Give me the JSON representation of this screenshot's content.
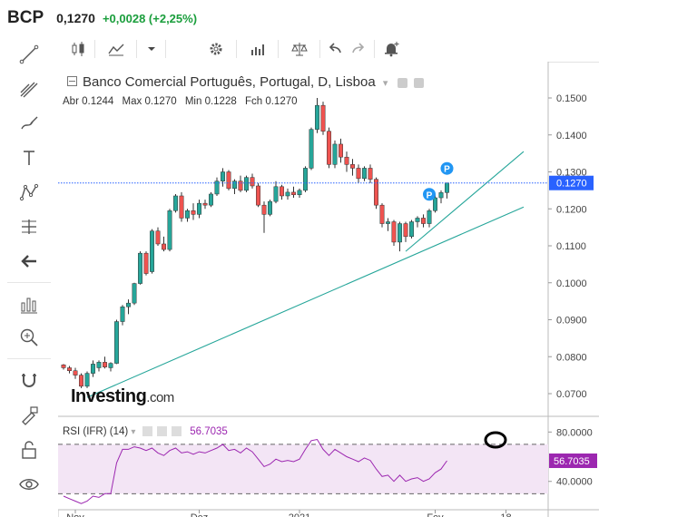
{
  "ticker": {
    "symbol": "BCP",
    "last": "0,1270",
    "change": "+0,0028 (+2,25%)"
  },
  "chart_header": {
    "title": "Banco Comercial Português, Portugal, D, Lisboa",
    "ohlc": [
      {
        "label": "Abr",
        "value": "0.1244"
      },
      {
        "label": "Max",
        "value": "0.1270"
      },
      {
        "label": "Min",
        "value": "0.1228"
      },
      {
        "label": "Fch",
        "value": "0.1270"
      }
    ]
  },
  "logo": {
    "main": "Investing",
    "suffix": ".com"
  },
  "rsi_header": {
    "label": "RSI (IFR) (14)",
    "value": "56.7035"
  },
  "colors": {
    "up": "#26a69a",
    "down": "#ef5350",
    "rsi": "#9c27b0",
    "trend": "#26a69a",
    "last_price": "#2962ff"
  },
  "chart_data": {
    "type": "candlestick",
    "y_ticks": [
      "0.1500",
      "0.1400",
      "0.1300",
      "0.1200",
      "0.1100",
      "0.1000",
      "0.0900",
      "0.0800",
      "0.0700"
    ],
    "ylim": [
      0.066,
      0.155
    ],
    "last_price": 0.127,
    "last_price_label": "0.1270",
    "x_ticks": [
      {
        "label": "Nov",
        "index": 2
      },
      {
        "label": "Dez",
        "index": 23
      },
      {
        "label": "2021",
        "index": 40
      },
      {
        "label": "Fev",
        "index": 63
      },
      {
        "label": "18",
        "index": 75
      }
    ],
    "ohlc": [
      [
        0.0778,
        0.078,
        0.0765,
        0.077
      ],
      [
        0.077,
        0.0775,
        0.0755,
        0.0762
      ],
      [
        0.0762,
        0.077,
        0.074,
        0.075
      ],
      [
        0.075,
        0.0755,
        0.0715,
        0.072
      ],
      [
        0.072,
        0.076,
        0.0715,
        0.0755
      ],
      [
        0.0755,
        0.079,
        0.0745,
        0.078
      ],
      [
        0.077,
        0.079,
        0.076,
        0.0785
      ],
      [
        0.0785,
        0.08,
        0.0768,
        0.0772
      ],
      [
        0.077,
        0.0785,
        0.076,
        0.0782
      ],
      [
        0.0782,
        0.09,
        0.078,
        0.0895
      ],
      [
        0.0895,
        0.094,
        0.0885,
        0.0935
      ],
      [
        0.0935,
        0.0955,
        0.0915,
        0.0945
      ],
      [
        0.0945,
        0.1,
        0.094,
        0.0998
      ],
      [
        0.0998,
        0.1085,
        0.0995,
        0.108
      ],
      [
        0.108,
        0.1085,
        0.102,
        0.1025
      ],
      [
        0.103,
        0.1145,
        0.1025,
        0.114
      ],
      [
        0.114,
        0.115,
        0.11,
        0.1105
      ],
      [
        0.1105,
        0.1125,
        0.1085,
        0.109
      ],
      [
        0.109,
        0.12,
        0.1085,
        0.1195
      ],
      [
        0.1195,
        0.124,
        0.119,
        0.1235
      ],
      [
        0.1235,
        0.1245,
        0.1165,
        0.1175
      ],
      [
        0.1175,
        0.12,
        0.1165,
        0.1195
      ],
      [
        0.1195,
        0.1215,
        0.117,
        0.1185
      ],
      [
        0.1185,
        0.1225,
        0.1175,
        0.1215
      ],
      [
        0.1215,
        0.1225,
        0.12,
        0.121
      ],
      [
        0.121,
        0.1245,
        0.1205,
        0.124
      ],
      [
        0.124,
        0.1285,
        0.1235,
        0.1275
      ],
      [
        0.1275,
        0.131,
        0.126,
        0.13
      ],
      [
        0.13,
        0.1305,
        0.125,
        0.1255
      ],
      [
        0.1255,
        0.128,
        0.124,
        0.1275
      ],
      [
        0.1275,
        0.129,
        0.1245,
        0.125
      ],
      [
        0.125,
        0.129,
        0.1245,
        0.1285
      ],
      [
        0.1285,
        0.1295,
        0.1255,
        0.1262
      ],
      [
        0.1262,
        0.127,
        0.1205,
        0.121
      ],
      [
        0.121,
        0.122,
        0.1135,
        0.1185
      ],
      [
        0.1185,
        0.1225,
        0.118,
        0.122
      ],
      [
        0.122,
        0.1275,
        0.1215,
        0.126
      ],
      [
        0.126,
        0.1265,
        0.1225,
        0.1235
      ],
      [
        0.1235,
        0.1255,
        0.1225,
        0.1245
      ],
      [
        0.1245,
        0.126,
        0.123,
        0.1238
      ],
      [
        0.1238,
        0.1255,
        0.123,
        0.125
      ],
      [
        0.125,
        0.1315,
        0.1245,
        0.131
      ],
      [
        0.131,
        0.142,
        0.1305,
        0.1415
      ],
      [
        0.1415,
        0.15,
        0.1405,
        0.148
      ],
      [
        0.148,
        0.149,
        0.14,
        0.141
      ],
      [
        0.141,
        0.142,
        0.131,
        0.132
      ],
      [
        0.132,
        0.1385,
        0.131,
        0.1375
      ],
      [
        0.1375,
        0.139,
        0.1325,
        0.134
      ],
      [
        0.134,
        0.1355,
        0.13,
        0.132
      ],
      [
        0.132,
        0.1335,
        0.129,
        0.131
      ],
      [
        0.131,
        0.132,
        0.127,
        0.1282
      ],
      [
        0.1282,
        0.1315,
        0.1275,
        0.131
      ],
      [
        0.131,
        0.132,
        0.127,
        0.128
      ],
      [
        0.128,
        0.1285,
        0.12,
        0.121
      ],
      [
        0.121,
        0.1215,
        0.115,
        0.116
      ],
      [
        0.116,
        0.1175,
        0.114,
        0.1165
      ],
      [
        0.1165,
        0.117,
        0.11,
        0.111
      ],
      [
        0.111,
        0.1165,
        0.1085,
        0.116
      ],
      [
        0.116,
        0.1165,
        0.111,
        0.1125
      ],
      [
        0.1125,
        0.117,
        0.112,
        0.1165
      ],
      [
        0.1165,
        0.118,
        0.115,
        0.1175
      ],
      [
        0.1175,
        0.1185,
        0.115,
        0.116
      ],
      [
        0.116,
        0.12,
        0.115,
        0.1195
      ],
      [
        0.1195,
        0.124,
        0.119,
        0.123
      ],
      [
        0.123,
        0.125,
        0.1215,
        0.1244
      ],
      [
        0.1244,
        0.127,
        0.1228,
        0.127
      ]
    ],
    "trendlines": [
      {
        "from": [
          4,
          0.069
        ],
        "to": [
          78,
          0.1205
        ]
      },
      {
        "from": [
          58,
          0.1085
        ],
        "to": [
          78,
          0.1355
        ]
      }
    ],
    "markers": [
      {
        "label": "P",
        "index": 62
      },
      {
        "label": "P",
        "index": 65
      }
    ],
    "rsi": {
      "name": "RSI (IFR) (14)",
      "ticks": [
        "80.0000",
        "40.0000"
      ],
      "ylim": [
        17,
        92
      ],
      "bands": [
        70,
        30
      ],
      "last_label": "56.7035",
      "values": [
        28,
        26,
        24,
        22,
        24,
        28,
        27,
        30,
        30,
        55,
        66,
        66,
        68,
        67,
        65,
        67,
        63,
        61,
        65,
        67,
        63,
        64,
        62,
        64,
        63,
        65,
        67,
        70,
        65,
        66,
        63,
        67,
        64,
        58,
        52,
        54,
        58,
        56,
        57,
        56,
        58,
        66,
        73,
        74,
        66,
        61,
        66,
        63,
        60,
        58,
        56,
        59,
        57,
        50,
        44,
        45,
        40,
        45,
        40,
        42,
        43,
        40,
        42,
        47,
        50,
        56.7
      ]
    }
  }
}
